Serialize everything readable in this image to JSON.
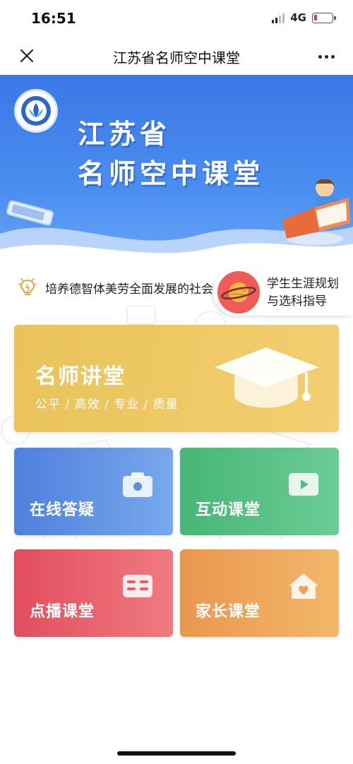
{
  "status_bar": {
    "time": "16:51",
    "network": "4G"
  },
  "nav": {
    "title": "江苏省名师空中课堂"
  },
  "banner": {
    "title_line1": "江苏省",
    "title_line2": "名师空中课堂"
  },
  "notice": {
    "text": "培养德智体美劳全面发展的社会主义建设者"
  },
  "career": {
    "line1": "学生生涯规划",
    "line2": "与选科指导"
  },
  "main_card": {
    "title": "名师讲堂",
    "subtitle": "公平 / 高效 / 专业 / 质量"
  },
  "tiles": [
    {
      "label": "在线答疑",
      "icon": "camera-icon"
    },
    {
      "label": "互动课堂",
      "icon": "play-icon"
    },
    {
      "label": "点播课堂",
      "icon": "book-icon"
    },
    {
      "label": "家长课堂",
      "icon": "home-heart-icon"
    }
  ],
  "colors": {
    "banner_blue": "#3a78e6",
    "main_card_yellow": "#efca66",
    "qa_blue": "#4f80dc",
    "interactive_green": "#47b676",
    "vod_red": "#e24d5e",
    "parent_orange": "#e9974e"
  }
}
